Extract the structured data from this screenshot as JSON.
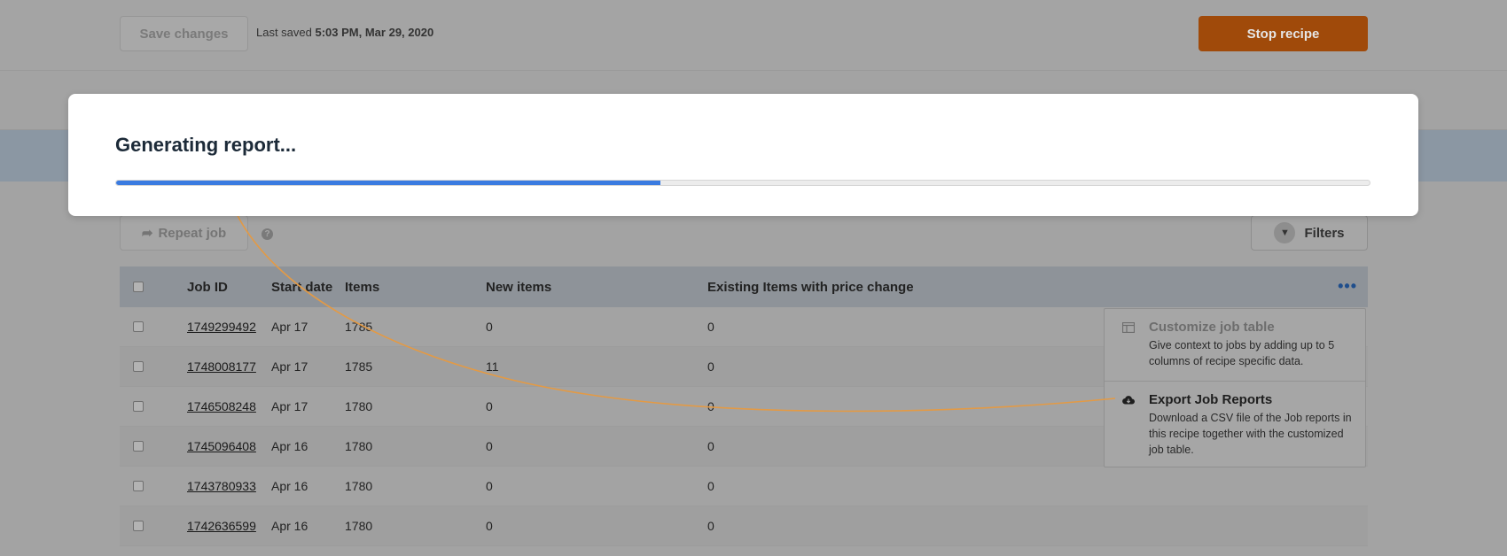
{
  "topbar": {
    "save_label": "Save changes",
    "last_saved_prefix": "Last saved ",
    "last_saved_time": "5:03 PM, Mar 29, 2020",
    "stop_label": "Stop recipe",
    "stop_color": "#a04a0a"
  },
  "toolbar": {
    "repeat_label": "Repeat job",
    "help_icon": "question-circle-icon",
    "filters_label": "Filters",
    "filters_icon": "filter-icon"
  },
  "table": {
    "headers": {
      "job_id": "Job ID",
      "start_date": "Start date",
      "items": "Items",
      "new_items": "New items",
      "existing": "Existing Items with price change"
    },
    "rows": [
      {
        "job_id": "1749299492",
        "start_date": "Apr 17",
        "items": "1785",
        "new_items": "0",
        "existing": "0"
      },
      {
        "job_id": "1748008177",
        "start_date": "Apr 17",
        "items": "1785",
        "new_items": "11",
        "existing": "0"
      },
      {
        "job_id": "1746508248",
        "start_date": "Apr 17",
        "items": "1780",
        "new_items": "0",
        "existing": "0"
      },
      {
        "job_id": "1745096408",
        "start_date": "Apr 16",
        "items": "1780",
        "new_items": "0",
        "existing": "0"
      },
      {
        "job_id": "1743780933",
        "start_date": "Apr 16",
        "items": "1780",
        "new_items": "0",
        "existing": "0"
      },
      {
        "job_id": "1742636599",
        "start_date": "Apr 16",
        "items": "1780",
        "new_items": "0",
        "existing": "0"
      }
    ]
  },
  "menu": {
    "items": [
      {
        "title": "Customize job table",
        "description": "Give context to jobs by adding up to 5 columns of recipe specific data.",
        "icon": "table-columns-icon"
      },
      {
        "title": "Export Job Reports",
        "description": "Download a CSV file of the Job reports in this recipe together with the customized job table.",
        "icon": "cloud-download-icon"
      }
    ]
  },
  "modal": {
    "title": "Generating report...",
    "progress": 0.434,
    "progress_color": "#3a7be0"
  }
}
